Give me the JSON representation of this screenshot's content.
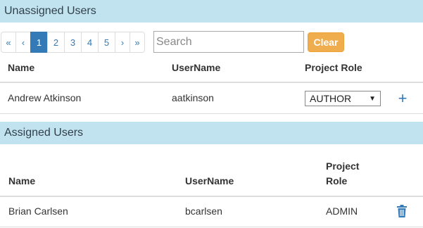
{
  "unassigned": {
    "header": "Unassigned Users",
    "pagination": {
      "first": "«",
      "prev": "‹",
      "pages": [
        "1",
        "2",
        "3",
        "4",
        "5"
      ],
      "next": "›",
      "last": "»",
      "active_page": "1"
    },
    "search": {
      "placeholder": "Search",
      "value": ""
    },
    "clear_label": "Clear",
    "columns": {
      "name": "Name",
      "username": "UserName",
      "role": "Project Role"
    },
    "rows": [
      {
        "name": "Andrew Atkinson",
        "username": "aatkinson",
        "role": "AUTHOR"
      }
    ]
  },
  "assigned": {
    "header": "Assigned Users",
    "columns": {
      "name": "Name",
      "username": "UserName",
      "role_line1": "Project",
      "role_line2": "Role"
    },
    "rows": [
      {
        "name": "Brian Carlsen",
        "username": "bcarlsen",
        "role": "ADMIN"
      }
    ]
  },
  "icons": {
    "add": "plus-icon",
    "remove": "trash-icon"
  },
  "colors": {
    "section_header_bg": "#c0e3ef",
    "link": "#337ab7",
    "active_page_bg": "#337ab7",
    "clear_button": "#f0ad4e"
  }
}
